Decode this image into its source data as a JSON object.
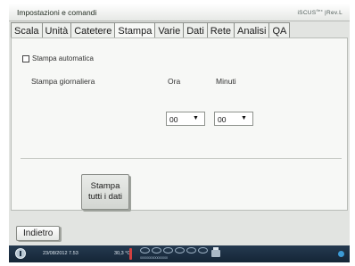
{
  "window": {
    "title": "Impostazioni e comandi",
    "brand": "iSCUS",
    "brand_sup": "flex",
    "brand_suffix": "|Rev.L"
  },
  "tabs": [
    {
      "label": "Scala",
      "active": false
    },
    {
      "label": "Unità",
      "active": false
    },
    {
      "label": "Catetere",
      "active": false
    },
    {
      "label": "Stampa",
      "active": true
    },
    {
      "label": "Varie",
      "active": false
    },
    {
      "label": "Dati",
      "active": false
    },
    {
      "label": "Rete",
      "active": false
    },
    {
      "label": "Analisi",
      "active": false
    },
    {
      "label": "QA",
      "active": false
    }
  ],
  "stampa": {
    "auto_print_label": "Stampa automatica",
    "auto_print_checked": false,
    "daily_print_label": "Stampa giornaliera",
    "hour_label": "Ora",
    "hour_value": "00",
    "minutes_label": "Minuti",
    "minutes_value": "00",
    "print_all_line1": "Stampa",
    "print_all_line2": "tutti i dati"
  },
  "footer": {
    "back_label": "Indietro"
  },
  "status_bar": {
    "datetime": "23/08/2012 7.53",
    "temperature": "30,3 °C",
    "sample_slots_text": "0000000000000000"
  },
  "colors": {
    "status_bar_bg": "#1c3044",
    "thermometer": "#d04040",
    "network_indicator": "#3c9bd6"
  }
}
